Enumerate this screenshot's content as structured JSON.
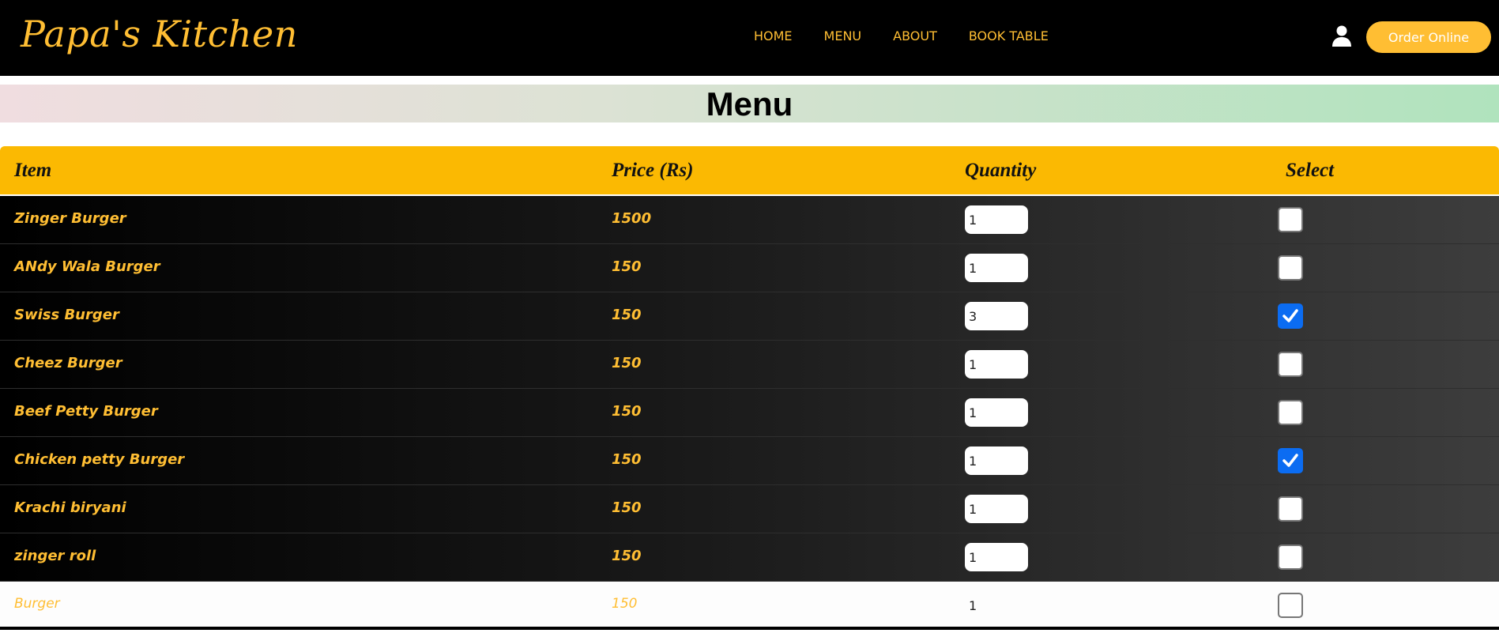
{
  "navbar": {
    "brand": "Papa's Kitchen",
    "links": [
      "HOME",
      "MENU",
      "ABOUT",
      "BOOK TABLE"
    ],
    "order_button": "Order Online",
    "accent_color": "#ffbe33"
  },
  "menu": {
    "heading": "Menu",
    "columns": [
      "Item",
      "Price (Rs)",
      "Quantity",
      "Select"
    ],
    "rows": [
      {
        "name": "Zinger Burger",
        "price": "1500",
        "quantity": "1",
        "selected": false
      },
      {
        "name": "ANdy Wala Burger",
        "price": "150",
        "quantity": "1",
        "selected": false
      },
      {
        "name": "Swiss Burger",
        "price": "150",
        "quantity": "3",
        "selected": true
      },
      {
        "name": "Cheez Burger",
        "price": "150",
        "quantity": "1",
        "selected": false
      },
      {
        "name": "Beef Petty Burger",
        "price": "150",
        "quantity": "1",
        "selected": false
      },
      {
        "name": "Chicken petty Burger",
        "price": "150",
        "quantity": "1",
        "selected": true
      },
      {
        "name": "Krachi biryani",
        "price": "150",
        "quantity": "1",
        "selected": false
      },
      {
        "name": "zinger roll",
        "price": "150",
        "quantity": "1",
        "selected": false
      },
      {
        "name": "Burger",
        "price": "150",
        "quantity": "1",
        "selected": false
      }
    ]
  },
  "icons": {
    "user": "user-icon",
    "check": "check-icon"
  },
  "colors": {
    "header_bar": "#fbb902",
    "checkbox_checked": "#0b6cf2"
  }
}
